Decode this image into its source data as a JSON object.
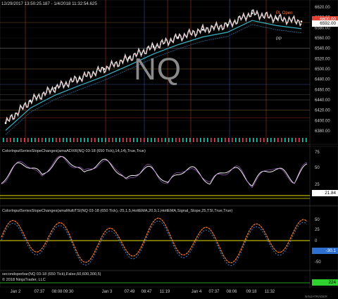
{
  "header": {
    "range": "12/29/2017 13:50:25.187 - 1/4/2018 11:32:54.625"
  },
  "watermark": "NQ",
  "colors": {
    "bg": "#000000",
    "grid": "#1d1d1d",
    "accent_yellow": "#e8e200",
    "price_tag": "#e34234",
    "green_tag": "#2fd12f"
  },
  "main_panel": {
    "y_ticks": [
      "6620.00",
      "6600.00",
      "6580.00",
      "6560.00",
      "6540.00",
      "6520.00",
      "6500.00",
      "6480.00",
      "6460.00",
      "6440.00",
      "6420.00",
      "6400.00",
      "6380.00"
    ],
    "current_price": "6592.00",
    "price_tag_2": "6600.00",
    "level_labels": [
      "PL Open",
      "PP"
    ]
  },
  "panel2": {
    "title": "ColorInputSeriesSlopeChanges(amaADXR(NQ 03-18 (650 Tick),14,14),True,True)",
    "y_ticks": [
      "75",
      "50",
      "25"
    ],
    "value": "21.84"
  },
  "panel3": {
    "title": "ColorInputSeriesSlopeChanges(amaMultiTSI(NQ 03-18 (650 Tick),-25,1,5,HoltEMA,20,9,1,HoltEMA,Signal_Slope,25,TSI,True,True)",
    "y_ticks": [
      "50",
      "25",
      "0",
      "-25",
      "-50"
    ],
    "value": "-30.1"
  },
  "panel4": {
    "title": "secondsperbar(NQ 03-18 (650 Tick),False,60,600,300,5)",
    "value": "224"
  },
  "copyright": "© 2018 NinjaTrader, LLC",
  "ninja_logo": "NINJATRADER",
  "x_ticks": [
    "Jan 2",
    "07:37",
    "08:08",
    "09:30",
    "Jan 3",
    "07:49",
    "08:47",
    "11:19",
    "Jan 4",
    "07:37",
    "08:06",
    "09:18",
    "11:32"
  ],
  "chart_data": {
    "type": "line",
    "title": "",
    "xlabel": "",
    "ylabel": "",
    "ylim": [
      6370,
      6630
    ],
    "x": [
      "Jan 2",
      "07:37",
      "08:08",
      "09:30",
      "Jan 3",
      "07:49",
      "08:47",
      "11:19",
      "Jan 4",
      "07:37",
      "08:06",
      "09:18",
      "11:32"
    ],
    "series": [
      {
        "values": [
          6395,
          6438,
          6463,
          6482,
          6500,
          6521,
          6543,
          6561,
          6576,
          6585,
          6608,
          6598,
          6592
        ]
      }
    ]
  }
}
